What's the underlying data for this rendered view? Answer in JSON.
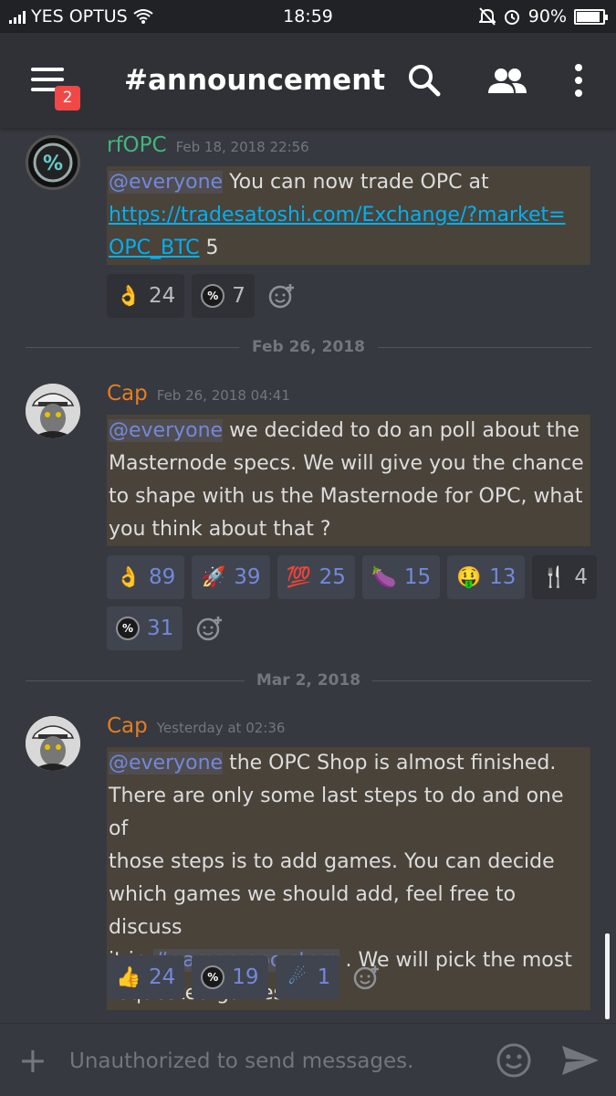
{
  "status_bar": {
    "carrier": "YES OPTUS",
    "time": "18:59",
    "battery": "90%",
    "battery_level": 0.9
  },
  "header": {
    "channel": "#announcement",
    "badge": "2"
  },
  "messages": [
    {
      "author": "rfOPC",
      "author_color": "#43b581",
      "timestamp": "Feb 18, 2018 22:56",
      "mention": "@everyone",
      "text1": " You can now trade OPC at",
      "link1": "https://tradesatoshi.com/Exchange/?market=",
      "link2": "OPC_BTC",
      "text2": " 5",
      "reactions": [
        {
          "emoji": "ok-hand-icon",
          "glyph": "👌",
          "count": "24"
        },
        {
          "emoji": "opc-icon",
          "glyph": "%",
          "count": "7"
        }
      ]
    },
    {
      "author": "Cap",
      "author_color": "#e67e22",
      "timestamp": "Feb 26, 2018 04:41",
      "mention": "@everyone",
      "line1": " we decided to do an poll about the",
      "line2": "Masternode specs. We will give you the chance",
      "line3": "to shape with us the Masternode for OPC, what",
      "line4": "you think about that ?",
      "reactions": [
        {
          "emoji": "ok-hand-icon",
          "glyph": "👌",
          "count": "89"
        },
        {
          "emoji": "rocket-icon",
          "glyph": "🚀",
          "count": "39"
        },
        {
          "emoji": "hundred-icon",
          "glyph": "💯",
          "count": "25"
        },
        {
          "emoji": "eggplant-icon",
          "glyph": "🍆",
          "count": "15"
        },
        {
          "emoji": "money-mouth-icon",
          "glyph": "🤑",
          "count": "13"
        },
        {
          "emoji": "fork-knife-icon",
          "glyph": "🍴",
          "count": "4"
        },
        {
          "emoji": "opc-icon",
          "glyph": "%",
          "count": "31"
        }
      ]
    },
    {
      "author": "Cap",
      "author_color": "#e67e22",
      "timestamp": "Yesterday at 02:36",
      "mention": "@everyone",
      "line1": " the OPC Shop is almost finished.",
      "line2": "There are only some last steps to do and one of",
      "line3": "those steps is to add games. You can decide",
      "line4": "which games we should add, feel free to discuss",
      "line5a": "it in ",
      "channel_mention": "#games-opc-store",
      "line5b": " . We will pick the most",
      "line6": "requested games.",
      "reactions": [
        {
          "emoji": "thumbs-up-icon",
          "glyph": "👍",
          "count": "24"
        },
        {
          "emoji": "opc-icon",
          "glyph": "%",
          "count": "19"
        },
        {
          "emoji": "comet-icon",
          "glyph": "☄",
          "count": "1"
        }
      ]
    }
  ],
  "dividers": [
    "Feb 26, 2018",
    "Mar 2, 2018"
  ],
  "input": {
    "placeholder": "Unauthorized to send messages."
  },
  "colors": {
    "background": "#36393f",
    "mention": "#7289da",
    "highlight": "#4a4339"
  }
}
